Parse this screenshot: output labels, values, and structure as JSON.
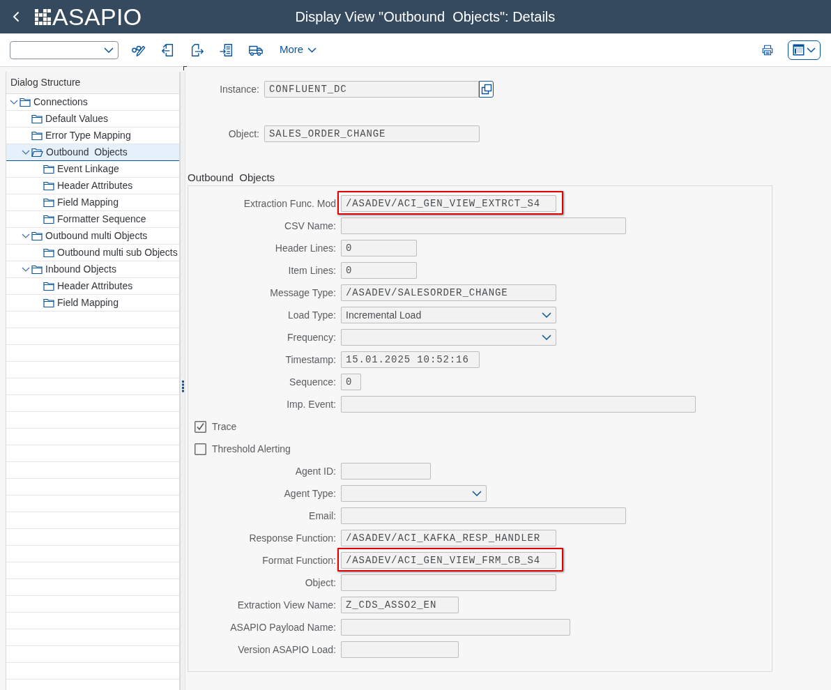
{
  "header": {
    "logo_text": "ASAPIO",
    "title": "Display View \"Outbound  Objects\": Details"
  },
  "toolbar": {
    "more_label": "More"
  },
  "sidebar": {
    "title": "Dialog Structure",
    "items": [
      {
        "label": "Connections",
        "expanded": true,
        "selected": false,
        "children": [
          {
            "label": "Default Values",
            "selected": false
          },
          {
            "label": "Error Type Mapping",
            "selected": false
          },
          {
            "label": "Outbound  Objects",
            "expanded": true,
            "selected": true,
            "children": [
              {
                "label": "Event Linkage",
                "selected": false
              },
              {
                "label": "Header Attributes",
                "selected": false
              },
              {
                "label": "Field Mapping",
                "selected": false
              },
              {
                "label": "Formatter Sequence",
                "selected": false
              }
            ]
          },
          {
            "label": "Outbound multi Objects",
            "expanded": true,
            "selected": false,
            "children": [
              {
                "label": "Outbound multi sub Objects",
                "selected": false
              }
            ]
          },
          {
            "label": "Inbound Objects",
            "expanded": true,
            "selected": false,
            "children": [
              {
                "label": "Header Attributes",
                "selected": false
              },
              {
                "label": "Field Mapping",
                "selected": false
              }
            ]
          }
        ]
      }
    ]
  },
  "top_fields": [
    {
      "kind": "input-help",
      "label": "Instance:",
      "value": "CONFLUENT_DC"
    },
    {
      "kind": "input",
      "label": "Object:",
      "value": "SALES_ORDER_CHANGE"
    }
  ],
  "section": {
    "title": "Outbound  Objects",
    "rows": [
      {
        "kind": "input",
        "label": "Extraction Func. Mod",
        "value": "/ASADEV/ACI_GEN_VIEW_EXTRCT_S4",
        "highlighted": true
      },
      {
        "kind": "input",
        "label": "CSV Name:",
        "highlighted": false
      },
      {
        "kind": "input",
        "label": "Header Lines:",
        "value": "0",
        "highlighted": false
      },
      {
        "kind": "input",
        "label": "Item Lines:",
        "value": "0",
        "highlighted": false
      },
      {
        "kind": "input",
        "label": "Message Type:",
        "value": "/ASADEV/SALESORDER_CHANGE",
        "highlighted": false
      },
      {
        "kind": "dropdown",
        "label": "Load Type:",
        "value": "Incremental Load",
        "highlighted": false
      },
      {
        "kind": "dropdown",
        "label": "Frequency:",
        "highlighted": false
      },
      {
        "kind": "input",
        "label": "Timestamp:",
        "value": "15.01.2025 10:52:16",
        "highlighted": false
      },
      {
        "kind": "input",
        "label": "Sequence:",
        "value": "0",
        "highlighted": false
      },
      {
        "kind": "input",
        "label": "Imp. Event:",
        "highlighted": false
      },
      {
        "kind": "checkbox",
        "label": "Trace",
        "checked": true,
        "highlighted": false
      },
      {
        "kind": "checkbox",
        "label": "Threshold Alerting",
        "checked": false,
        "highlighted": false
      },
      {
        "kind": "input",
        "label": "Agent ID:",
        "highlighted": false
      },
      {
        "kind": "dropdown",
        "label": "Agent Type:",
        "highlighted": false
      },
      {
        "kind": "input",
        "label": "Email:",
        "highlighted": false
      },
      {
        "kind": "input",
        "label": "Response Function:",
        "value": "/ASADEV/ACI_KAFKA_RESP_HANDLER",
        "highlighted": false
      },
      {
        "kind": "input",
        "label": "Format Function:",
        "value": "/ASADEV/ACI_GEN_VIEW_FRM_CB_S4",
        "highlighted": true
      },
      {
        "kind": "input",
        "label": "Object:",
        "highlighted": false
      },
      {
        "kind": "input",
        "label": "Extraction View Name:",
        "value": "Z_CDS_ASSO2_EN",
        "highlighted": false
      },
      {
        "kind": "input",
        "label": "ASAPIO Payload Name:",
        "highlighted": false
      },
      {
        "kind": "input",
        "label": "Version ASAPIO Load:",
        "highlighted": false
      }
    ]
  }
}
